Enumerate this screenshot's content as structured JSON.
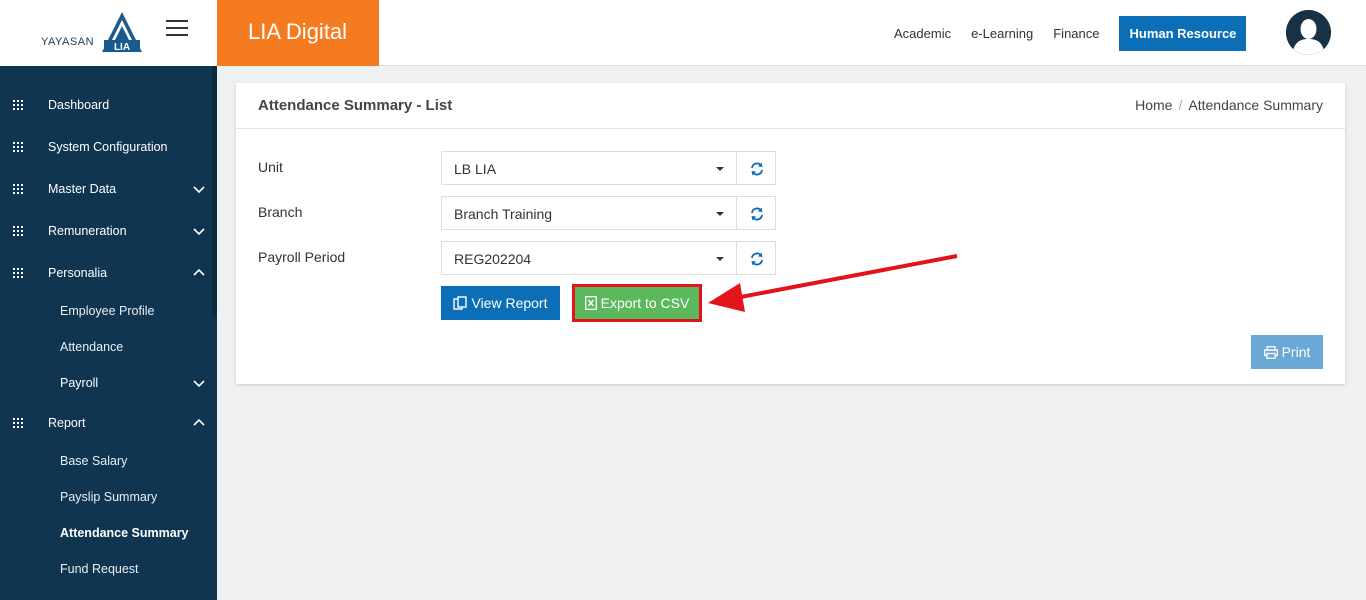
{
  "header": {
    "logo_text": "YAYASAN",
    "logo_mark_text": "LIA",
    "brand": "LIA Digital",
    "nav": [
      "Academic",
      "e-Learning",
      "Finance",
      "Human Resource"
    ],
    "active_nav": "Human Resource"
  },
  "sidebar": {
    "items": [
      {
        "label": "Dashboard"
      },
      {
        "label": "System Configuration"
      },
      {
        "label": "Master Data"
      },
      {
        "label": "Remuneration"
      },
      {
        "label": "Personalia"
      },
      {
        "label": "Employee Profile"
      },
      {
        "label": "Attendance"
      },
      {
        "label": "Payroll"
      },
      {
        "label": "Report"
      },
      {
        "label": "Base Salary"
      },
      {
        "label": "Payslip Summary"
      },
      {
        "label": "Attendance Summary"
      },
      {
        "label": "Fund Request"
      }
    ]
  },
  "page": {
    "title": "Attendance Summary - List",
    "breadcrumb": [
      "Home",
      "Attendance Summary"
    ]
  },
  "form": {
    "unit_label": "Unit",
    "unit_value": "LB LIA",
    "branch_label": "Branch",
    "branch_value": "Branch Training",
    "period_label": "Payroll Period",
    "period_value": "REG202204"
  },
  "buttons": {
    "view_report": "View Report",
    "export_csv": "Export to CSV",
    "print": "Print"
  },
  "colors": {
    "brand": "#f47b20",
    "sidebar": "#0f3550",
    "primary": "#0b6eb6",
    "export": "#5cb85c",
    "highlight": "#e3131b"
  }
}
